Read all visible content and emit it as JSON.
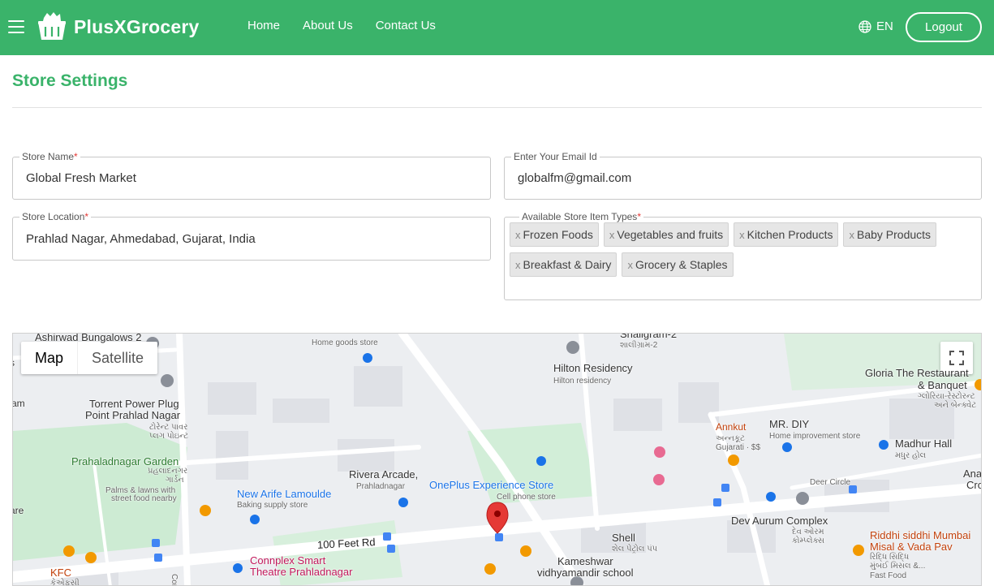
{
  "header": {
    "brand": "PlusXGrocery",
    "nav": [
      "Home",
      "About Us",
      "Contact Us"
    ],
    "language": "EN",
    "logout_label": "Logout",
    "colors": {
      "brand_green": "#3ab36a"
    }
  },
  "page": {
    "title": "Store Settings"
  },
  "form": {
    "store_name": {
      "label": "Store Name",
      "required": "*",
      "value": "Global Fresh Market"
    },
    "email": {
      "label": "Enter Your Email Id",
      "value": "globalfm@gmail.com"
    },
    "store_location": {
      "label": "Store Location",
      "required": "*",
      "value": "Prahlad Nagar, Ahmedabad, Gujarat, India"
    },
    "item_types": {
      "label": "Available Store Item Types",
      "required": "*",
      "remove_glyph": "x",
      "chips": [
        "Frozen Foods",
        "Vegetables and fruits",
        "Kitchen Products",
        "Baby Products",
        "Breakfast & Dairy",
        "Grocery & Staples"
      ]
    }
  },
  "map": {
    "controls": {
      "map": "Map",
      "satellite": "Satellite"
    },
    "labels": {
      "ashirwad": "Ashirwad Bungalows 2",
      "home_goods": "Home goods store",
      "shaligram": "Shaligram-2",
      "shaligram_gu": "શાલીગ્રામ-2",
      "hilton": "Hilton Residency",
      "hilton_sub": "Hilton residency",
      "gloria": "Gloria The Restaurant",
      "gloria2": "& Banquet",
      "gloria_gu": "ગ્લોરિયા-રેસ્ટોરન્ટ",
      "gloria_gu2": "અને બેન્ક્વેટ",
      "torrent1": "Torrent Power Plug",
      "torrent2": "Point Prahlad Nagar",
      "torrent_gu": "ટોરેન્ટ પાવર",
      "torrent_gu2": "પ્લગ પોઇન્ટ",
      "ankut": "Annkut",
      "ankut_gu": "અન્નકૂટ",
      "ankut_sub": "Gujarati · $$",
      "mrdiy": "MR. DIY",
      "mrdiy_sub": "Home improvement store",
      "madhur": "Madhur Hall",
      "madhur_gu": "મધુર હોલ",
      "garden": "Prahaladnagar Garden",
      "garden_gu": "પ્રહલાદનગર",
      "garden_gu2": "ગાર્ડન",
      "garden_sub1": "Palms & lawns with",
      "garden_sub2": "street food nearby",
      "rivera1": "Rivera Arcade,",
      "rivera2": "Prahladnagar",
      "oneplus": "OnePlus Experience Store",
      "oneplus_sub": "Cell phone store",
      "deer": "Deer Circle",
      "arife": "New Arife Lamoulde",
      "arife_sub": "Baking supply store",
      "dev1": "Dev Aurum Complex",
      "dev_gu": "દેવ ઓરમ",
      "dev_gu2": "કોમ્પ્લેક્સ",
      "road": "100 Feet Rd",
      "shell": "Shell",
      "shell_gu": "શેલ પેટ્રોલ પંપ",
      "kameshwar1": "Kameshwar",
      "kameshwar2": "vidhyamandir school",
      "riddhi1": "Riddhi siddhi Mumbai",
      "riddhi2": "Misal & Vada Pav",
      "riddhi_gu": "રિદ્ધિ સિદ્ધિ",
      "riddhi_gu2": "મુંબઈ મિસલ &...",
      "riddhi_sub": "Fast Food",
      "kfc": "KFC",
      "kfc_gu": "કેએફસી",
      "conn1": "Connplex Smart",
      "conn2": "Theatre Prahladnagar",
      "corp": "Corpo",
      "anan": "Anan",
      "cros": "Cros",
      "rs": "rs",
      "am": "am",
      "are": "are"
    }
  }
}
